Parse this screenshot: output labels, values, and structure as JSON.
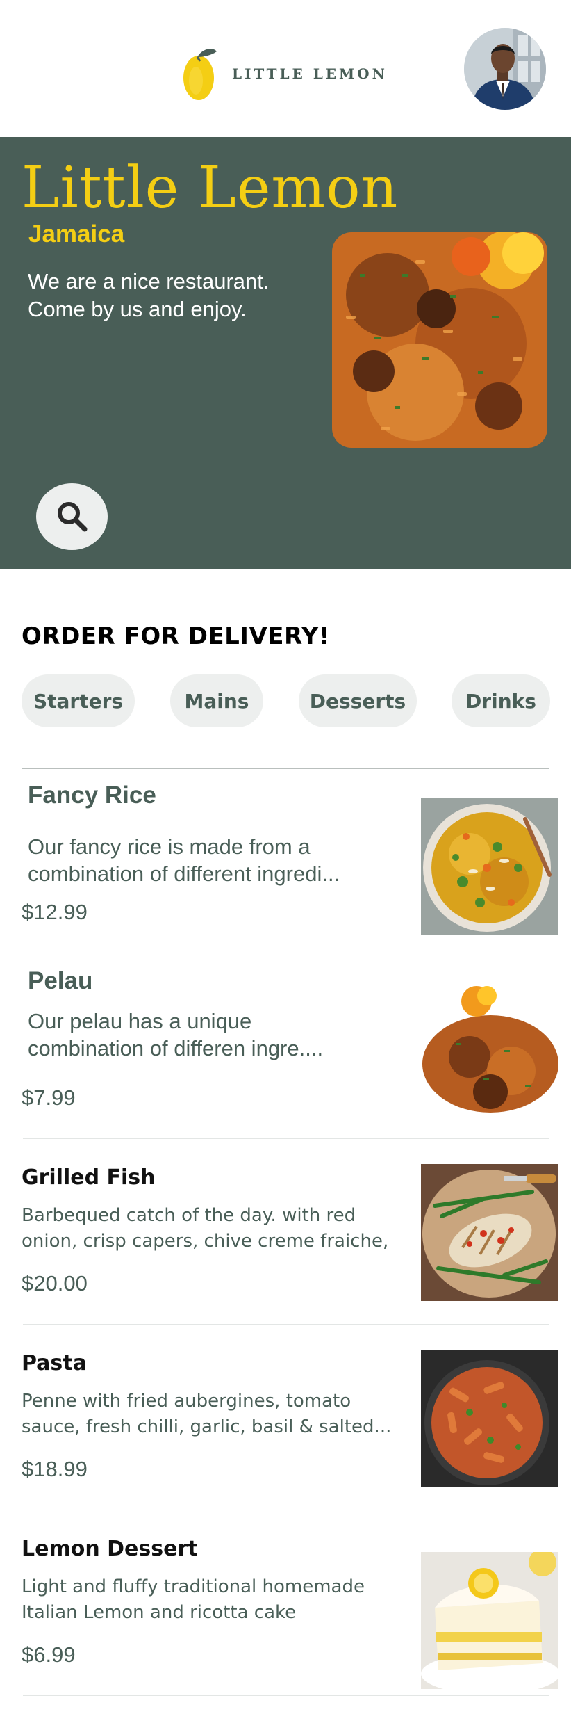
{
  "header": {
    "logo_text": "LITTLE LEMON",
    "logo_icon": "lemon-logo-icon",
    "avatar_icon": "profile-avatar"
  },
  "hero": {
    "title": "Little Lemon",
    "city": "Jamaica",
    "description_lines": [
      "We are a nice restaurant.",
      "Come by us and enjoy."
    ],
    "image_icon": "pelau-dish-image",
    "search_icon": "search-icon"
  },
  "order": {
    "title": "ORDER FOR DELIVERY!",
    "categories": [
      "Starters",
      "Mains",
      "Desserts",
      "Drinks"
    ]
  },
  "menu": [
    {
      "name": "Fancy Rice",
      "description_lines": [
        "Our fancy rice is made from a",
        "combination of different ingredi..."
      ],
      "price": "$12.99",
      "image_icon": "fancy-rice-image"
    },
    {
      "name": "Pelau",
      "description_lines": [
        "Our pelau has a unique",
        "combination of differen ingre...."
      ],
      "price": "$7.99",
      "image_icon": "pelau-image"
    },
    {
      "name": "Grilled Fish",
      "description_lines": [
        "Barbequed catch of the day. with red",
        "onion, crisp capers, chive creme fraiche,"
      ],
      "price": "$20.00",
      "image_icon": "grilled-fish-image"
    },
    {
      "name": "Pasta",
      "description_lines": [
        "Penne with fried aubergines,  tomato",
        "sauce, fresh chilli, garlic, basil & salted..."
      ],
      "price": "$18.99",
      "image_icon": "pasta-image"
    },
    {
      "name": "Lemon Dessert",
      "description_lines": [
        "Light and fluffy traditional homemade",
        "Italian Lemon and ricotta cake"
      ],
      "price": "$6.99",
      "image_icon": "lemon-dessert-image"
    }
  ],
  "colors": {
    "primary_green": "#495E57",
    "primary_yellow": "#F4CE14",
    "chip_background": "#EDEFEE"
  }
}
